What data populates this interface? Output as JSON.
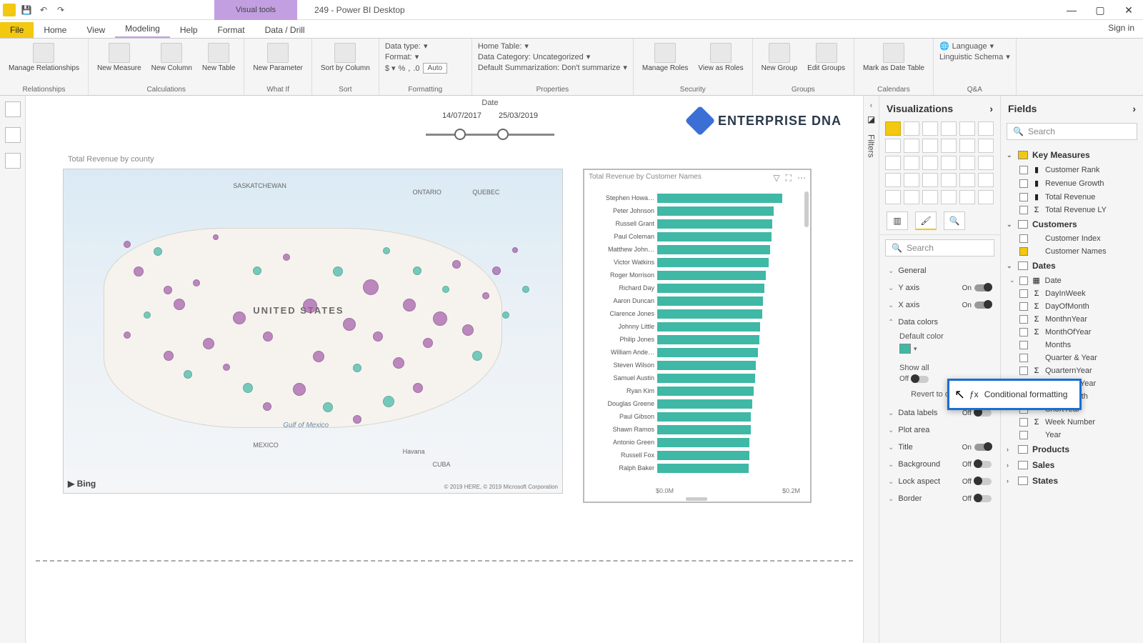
{
  "titlebar": {
    "context_tab": "Visual tools",
    "title": "249 - Power BI Desktop"
  },
  "menutabs": {
    "file": "File",
    "items": [
      "Home",
      "View",
      "Modeling",
      "Help",
      "Format",
      "Data / Drill"
    ],
    "active": "Modeling",
    "signin": "Sign in"
  },
  "ribbon": {
    "groups": {
      "relationships": {
        "label": "Relationships",
        "btn": "Manage\nRelationships"
      },
      "calculations": {
        "label": "Calculations",
        "btns": [
          "New\nMeasure",
          "New\nColumn",
          "New\nTable"
        ]
      },
      "whatif": {
        "label": "What If",
        "btn": "New\nParameter"
      },
      "sort": {
        "label": "Sort",
        "btn": "Sort by\nColumn"
      },
      "formatting": {
        "label": "Formatting",
        "datatype": "Data type:",
        "format": "Format:",
        "auto": "Auto"
      },
      "properties": {
        "label": "Properties",
        "hometable": "Home Table:",
        "datacat": "Data Category: Uncategorized",
        "defsum": "Default Summarization: Don't summarize"
      },
      "security": {
        "label": "Security",
        "btns": [
          "Manage\nRoles",
          "View as\nRoles"
        ]
      },
      "groupsg": {
        "label": "Groups",
        "btns": [
          "New\nGroup",
          "Edit\nGroups"
        ]
      },
      "calendars": {
        "label": "Calendars",
        "btn": "Mark as\nDate Table"
      },
      "qa": {
        "label": "Q&A",
        "lang": "Language",
        "schema": "Linguistic Schema"
      }
    }
  },
  "canvas": {
    "date_label": "Date",
    "date_from": "14/07/2017",
    "date_to": "25/03/2019",
    "logo": "ENTERPRISE DNA",
    "map_title": "Total Revenue by county",
    "map_country": "UNITED STATES",
    "map_gulf": "Gulf of Mexico",
    "map_bing": "Bing",
    "map_attr": "© 2019 HERE, © 2019 Microsoft Corporation",
    "map_cities": {
      "mexico": "MEXICO",
      "havana": "Havana",
      "cuba": "CUBA",
      "quebec": "QUEBEC",
      "ontario": "ONTARIO",
      "saskatchewan": "SASKATCHEWAN"
    },
    "bar_title": "Total Revenue by Customer Names",
    "bar_x0": "$0.0M",
    "bar_x1": "$0.2M"
  },
  "chart_data": {
    "type": "bar",
    "orientation": "horizontal",
    "title": "Total Revenue by Customer Names",
    "xlabel": "Total Revenue",
    "ylabel": "Customer Names",
    "xlim": [
      0,
      0.25
    ],
    "x_unit": "$M",
    "categories": [
      "Stephen Howa…",
      "Peter Johnson",
      "Russell Grant",
      "Paul Coleman",
      "Matthew John…",
      "Victor Watkins",
      "Roger Morrison",
      "Richard Day",
      "Aaron Duncan",
      "Clarence Jones",
      "Johnny Little",
      "Philip Jones",
      "William Ande…",
      "Steven Wilson",
      "Samuel Austin",
      "Ryan Kim",
      "Douglas Greene",
      "Paul Gibson",
      "Shawn Ramos",
      "Antonio Green",
      "Russell Fox",
      "Ralph Baker"
    ],
    "values": [
      0.23,
      0.215,
      0.212,
      0.21,
      0.208,
      0.205,
      0.2,
      0.198,
      0.195,
      0.193,
      0.19,
      0.188,
      0.185,
      0.182,
      0.18,
      0.178,
      0.175,
      0.173,
      0.172,
      0.17,
      0.17,
      0.168
    ]
  },
  "filters_label": "Filters",
  "vizpane": {
    "title": "Visualizations",
    "search": "Search",
    "format": {
      "general": "General",
      "yaxis": "Y axis",
      "xaxis": "X axis",
      "datacolors": "Data colors",
      "defaultcolor": "Default color",
      "showall": "Show all",
      "revert": "Revert to default",
      "datalabels": "Data labels",
      "plotarea": "Plot area",
      "titlef": "Title",
      "background": "Background",
      "lockaspect": "Lock aspect",
      "border": "Border",
      "on": "On",
      "off": "Off"
    }
  },
  "fields": {
    "title": "Fields",
    "search": "Search",
    "tables": {
      "keymeasures": {
        "name": "Key Measures",
        "fields": [
          {
            "name": "Customer Rank",
            "type": "measure",
            "checked": false
          },
          {
            "name": "Revenue Growth",
            "type": "measure",
            "checked": false
          },
          {
            "name": "Total Revenue",
            "type": "measure",
            "checked": false
          },
          {
            "name": "Total Revenue LY",
            "type": "sigma",
            "checked": false
          }
        ]
      },
      "customers": {
        "name": "Customers",
        "fields": [
          {
            "name": "Customer Index",
            "type": "",
            "checked": false
          },
          {
            "name": "Customer Names",
            "type": "",
            "checked": true
          }
        ]
      },
      "dates": {
        "name": "Dates",
        "fields": [
          {
            "name": "Date",
            "type": "date",
            "checked": false
          },
          {
            "name": "DayInWeek",
            "type": "sigma",
            "checked": false
          },
          {
            "name": "DayOfMonth",
            "type": "sigma",
            "checked": false
          },
          {
            "name": "MonthnYear",
            "type": "sigma",
            "checked": false
          },
          {
            "name": "MonthOfYear",
            "type": "sigma",
            "checked": false
          },
          {
            "name": "Months",
            "type": "",
            "checked": false
          },
          {
            "name": "Quarter & Year",
            "type": "",
            "checked": false
          },
          {
            "name": "QuarternYear",
            "type": "sigma",
            "checked": false
          },
          {
            "name": "QuarterOfYear",
            "type": "sigma",
            "checked": false
          },
          {
            "name": "Short Month",
            "type": "",
            "checked": false
          },
          {
            "name": "ShortYear",
            "type": "",
            "checked": false
          },
          {
            "name": "Week Number",
            "type": "sigma",
            "checked": false
          },
          {
            "name": "Year",
            "type": "",
            "checked": false
          }
        ]
      },
      "products": {
        "name": "Products"
      },
      "sales": {
        "name": "Sales"
      },
      "states": {
        "name": "States"
      }
    }
  },
  "ctxmenu": {
    "conditional": "Conditional formatting"
  }
}
